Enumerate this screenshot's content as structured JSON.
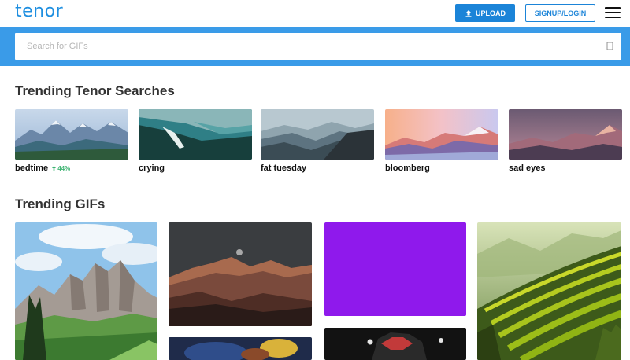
{
  "header": {
    "logo": "tenor",
    "upload_label": "UPLOAD",
    "login_label": "SIGNUP/LOGIN"
  },
  "search": {
    "placeholder": "Search for GIFs"
  },
  "sections": {
    "trending_searches_title": "Trending Tenor Searches",
    "trending_gifs_title": "Trending GIFs"
  },
  "trending_searches": [
    {
      "label": "bedtime",
      "trend": "44%"
    },
    {
      "label": "crying"
    },
    {
      "label": "fat tuesday"
    },
    {
      "label": "bloomberg"
    },
    {
      "label": "sad eyes"
    }
  ],
  "colors": {
    "brand_blue": "#1b84d8",
    "search_band": "#3a9be8",
    "trend_green": "#3cb371"
  },
  "icons": [
    "upload-icon",
    "menu-icon",
    "search-icon",
    "trend-up-icon"
  ]
}
